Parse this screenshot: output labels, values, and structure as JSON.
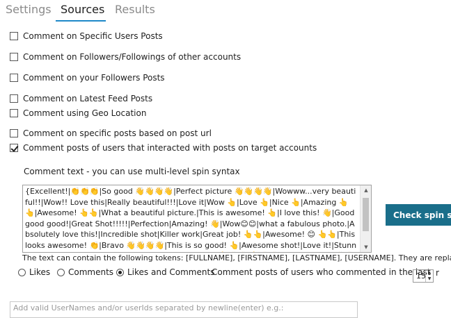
{
  "tabs": [
    {
      "label": "Settings"
    },
    {
      "label": "Sources"
    },
    {
      "label": "Results"
    }
  ],
  "options": [
    {
      "label": "Comment on Specific Users Posts",
      "checked": false
    },
    {
      "label": "Comment on Followers/Followings of other accounts",
      "checked": false
    },
    {
      "label": "Comment on your Followers Posts",
      "checked": false
    },
    {
      "label": "Comment on Latest Feed Posts",
      "checked": false
    },
    {
      "label": "Comment using Geo Location",
      "checked": false
    },
    {
      "label": "Comment on specific posts based on post url",
      "checked": false
    },
    {
      "label": "Comment posts of users that interacted with posts on target accounts",
      "checked": true
    }
  ],
  "comment_text": {
    "label": "Comment text - you can use multi-level spin syntax",
    "value": "{Excellent!|👏👏👏|So good 👋👋👋👋|Perfect picture 👋👋👋👋|Wowww...very beautiful!!|Wow!! Love this|Really beautiful!!!|Love it|Wow 👆|Love 👆|Nice 👆|Amazing 👆👆|Awesome! 👆👆|What a beautiful picture.|This is awesome! 👆|I love this! 👋|Good good good!|Great Shot!!!!!|Perfection|Amazing! 👋|Wow😊😊|what a fabulous photo.|Absolutely love this!|Incredible shot|Killer work|Great job! 👆👆|Awesome! 😊 👆👆|This looks awesome! 👏|Bravo 👋👋👋👋|This is so good! 👆|Awesome shot!|Love it!|Stunning!|Oh that's good!|So cool! Love it|Fabulous shot👆👋👋|👆👋👋|excellent shot👋👋|",
    "check_button": "Check spin synta",
    "tokens_text": "The text can contain the following tokens: [FULLNAME], [FIRSTNAME], [LASTNAME], [USERNAME]. They are replaced"
  },
  "radios": [
    {
      "label": "Likes",
      "checked": false
    },
    {
      "label": "Comments",
      "checked": false
    },
    {
      "label": "Likes and Comments",
      "checked": true
    }
  ],
  "commented_in_last": {
    "label": "Comment posts of users who commented in the last",
    "value": "15",
    "tail": "r"
  },
  "usernames_input": {
    "placeholder": "Add valid UserNames and/or userIds separated by newline(enter) e.g.:"
  }
}
